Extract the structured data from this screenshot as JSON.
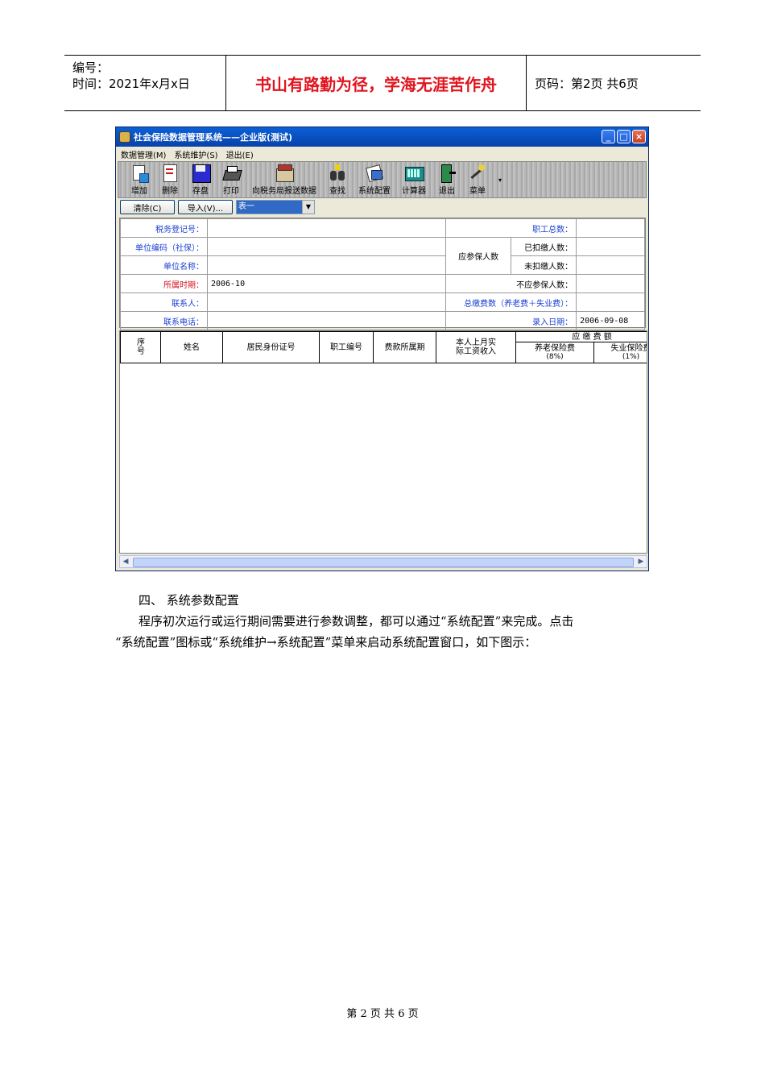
{
  "doc_header": {
    "serial_label": "编号：",
    "time_label": "时间：2021年x月x日",
    "motto": "书山有路勤为径，学海无涯苦作舟",
    "page_info": "页码：第2页  共6页"
  },
  "window": {
    "title": "社会保险数据管理系统——企业版(测试)",
    "controls": {
      "minimize": "_",
      "maximize": "□",
      "close": "×"
    },
    "menu": [
      "数据管理(M)",
      "系统维护(S)",
      "退出(E)"
    ],
    "toolbar": [
      "增加",
      "删除",
      "存盘",
      "打印",
      "向税务局报送数据",
      "查找",
      "系统配置",
      "计算器",
      "退出",
      "菜单"
    ],
    "actions": {
      "clear": "清除(C)",
      "import": "导入(V)...",
      "sheet": "表一"
    }
  },
  "form": {
    "tax_reg_no": "税务登记号：",
    "unit_code": "单位编码（社保）：",
    "unit_name": "单位名称：",
    "period_label": "所属时期：",
    "period_value": "2006-10",
    "contact": "联系人：",
    "phone": "联系电话：",
    "total_workers": "职工总数：",
    "should_insured": "应参保人数",
    "deducted": "已扣缴人数：",
    "not_deducted": "未扣缴人数：",
    "not_required": "不应参保人数：",
    "total_fee": "总缴费数（养老费＋失业费）：",
    "entry_date_label": "录入日期：",
    "entry_date_value": "2006-09-08"
  },
  "grid": {
    "headers": [
      "序号",
      "姓名",
      "居民身份证号",
      "职工编号",
      "费款所属期",
      "本人上月实际工资收入"
    ],
    "payable_group": "应  缴  费  额",
    "pension": "养老保险费",
    "pension_rate": "(8%)",
    "unemployment": "失业保险费",
    "unemployment_rate": "(1%)"
  },
  "body": {
    "section": "四、  系统参数配置",
    "line1": "程序初次运行或运行期间需要进行参数调整，都可以通过“系统配置”来完成。点击",
    "line2": "“系统配置”图标或“系统维护→系统配置”菜单来启动系统配置窗口，如下图示："
  },
  "footer": "第 2 页 共 6 页"
}
